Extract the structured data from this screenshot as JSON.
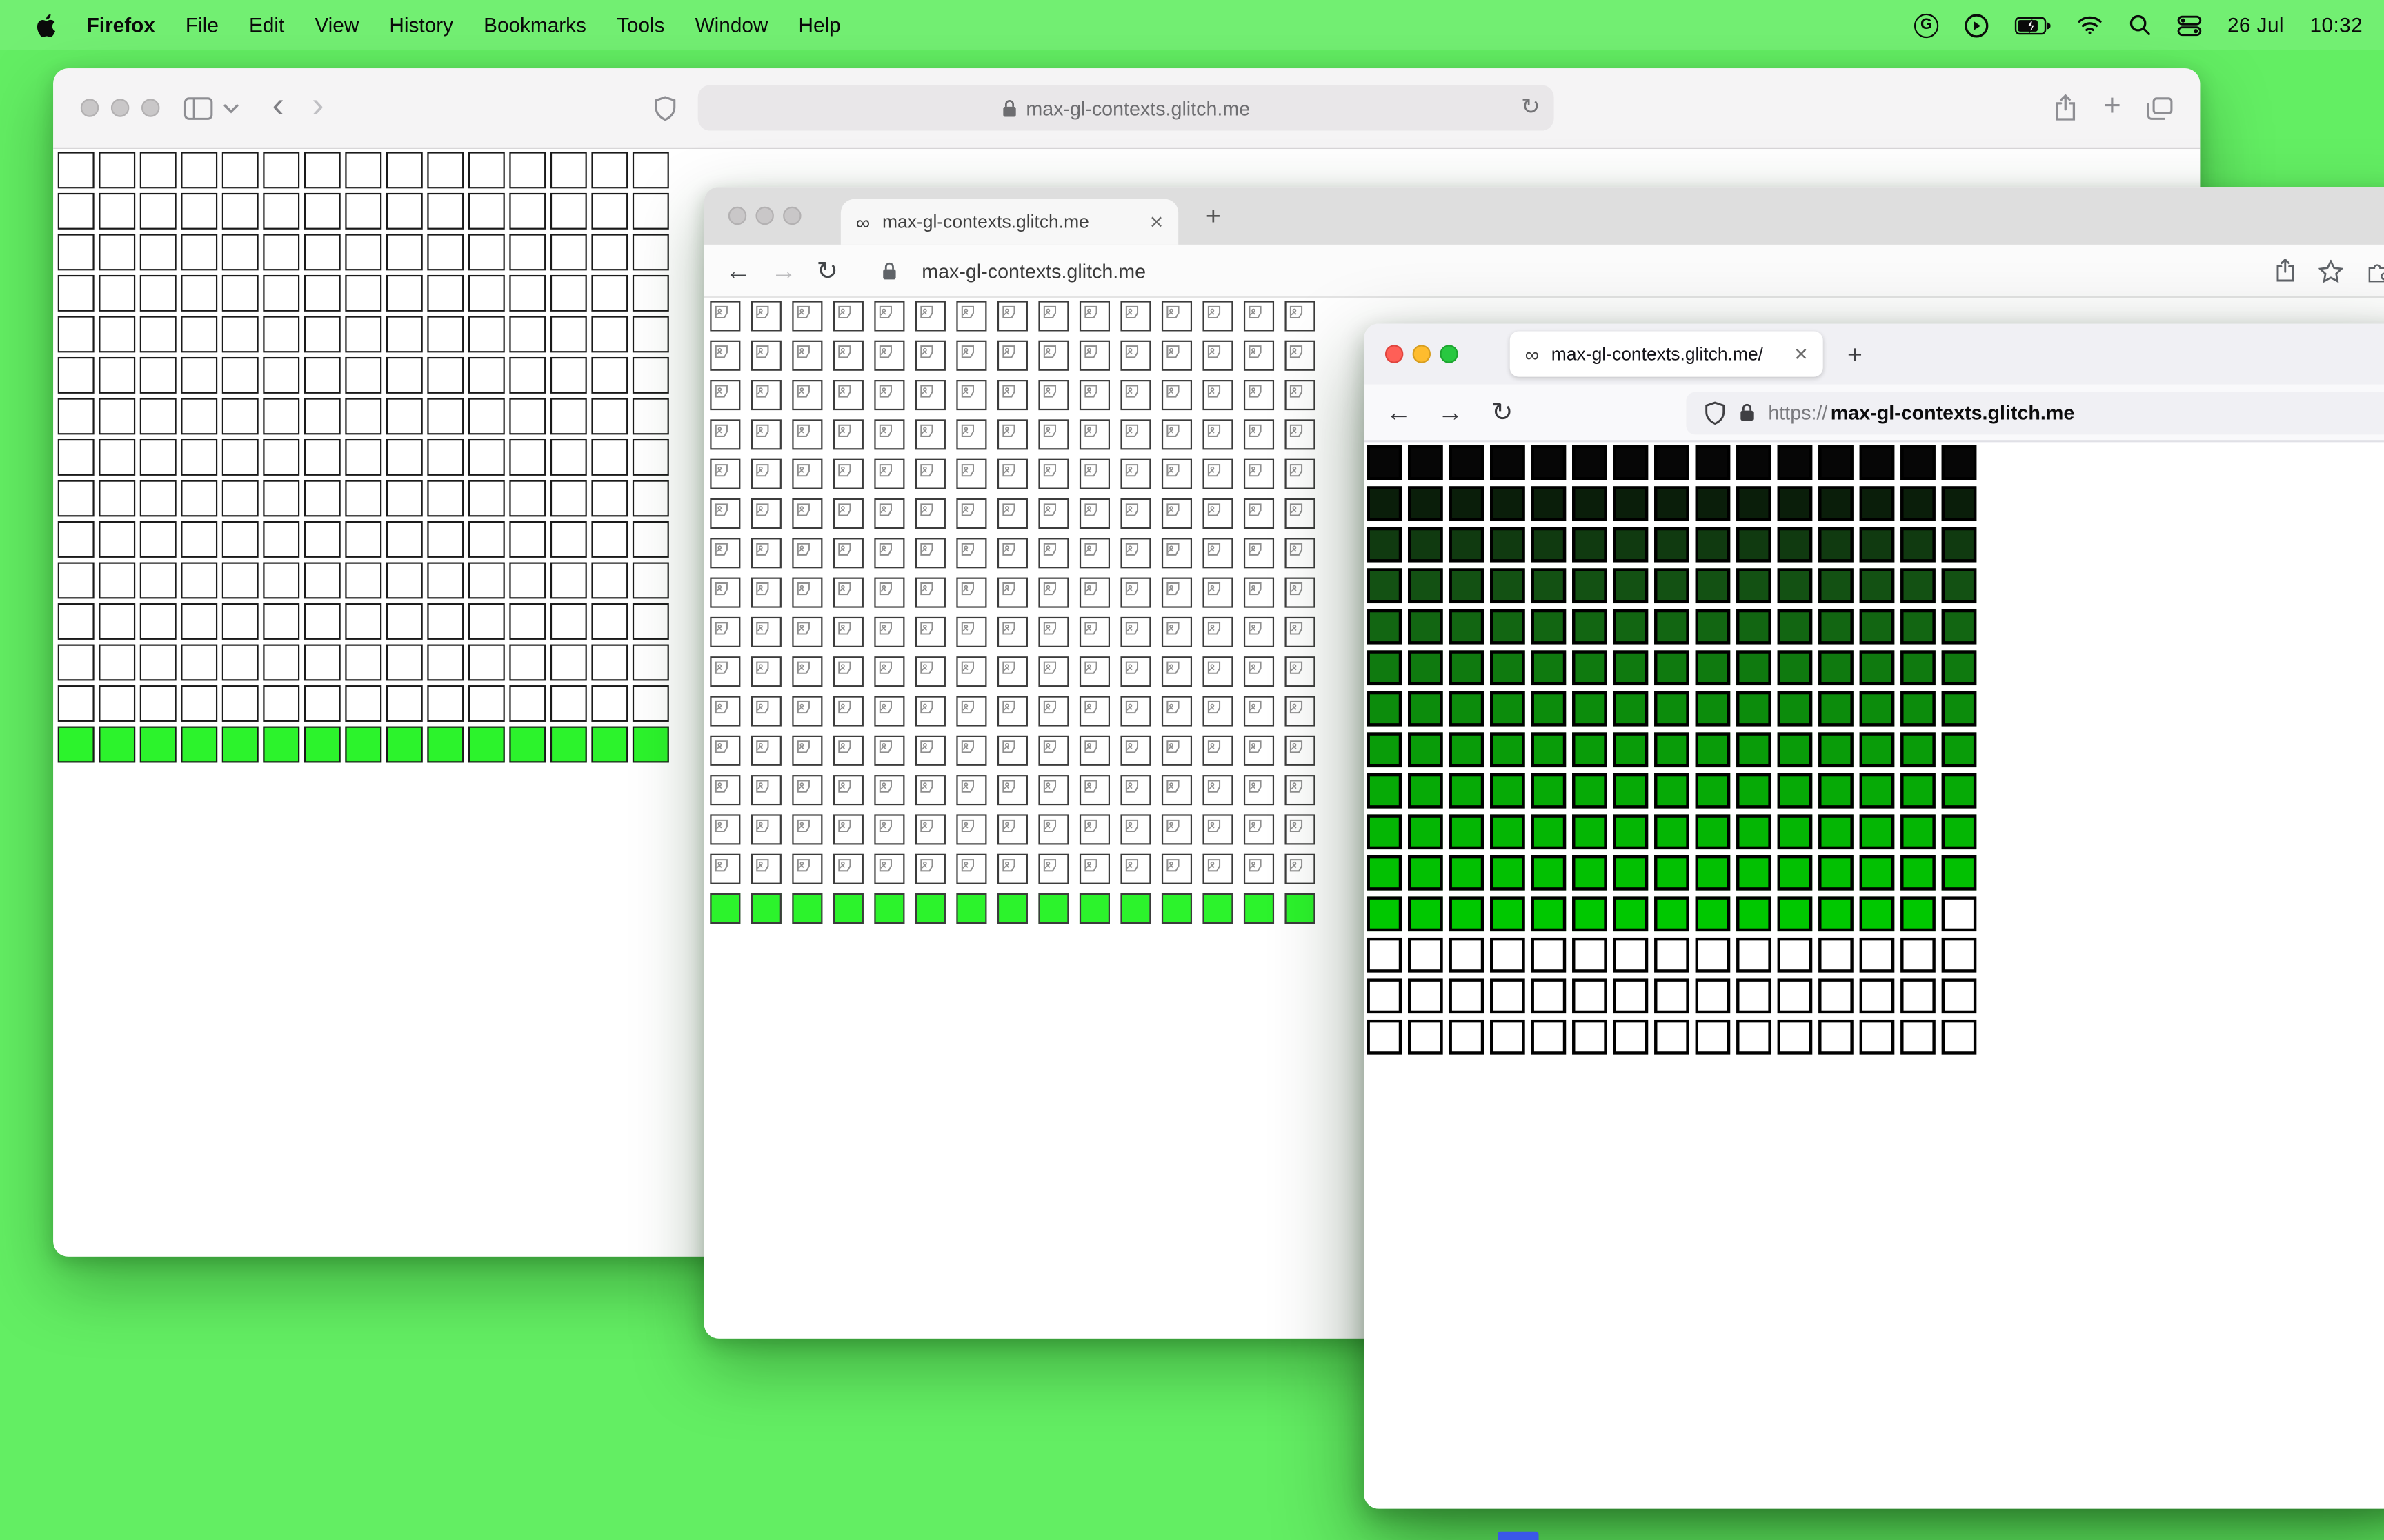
{
  "desktop": {
    "background_color": "#63ee63",
    "dock_accent_color": "#3a57e8"
  },
  "menu_bar": {
    "app_name": "Firefox",
    "menus": [
      "File",
      "Edit",
      "View",
      "History",
      "Bookmarks",
      "Tools",
      "Window",
      "Help"
    ],
    "date": "26 Jul",
    "time": "10:32",
    "status_icon_names": [
      "g-circle-icon",
      "play-circle-icon",
      "battery-charging-icon",
      "wifi-icon",
      "spotlight-search-icon",
      "control-center-icon"
    ]
  },
  "glyphs": {
    "infinity": "∞",
    "close": "×",
    "plus": "+",
    "back_chevron": "‹",
    "forward_chevron": "›",
    "back_arrow": "←",
    "forward_arrow": "→",
    "reload": "↻",
    "g_letter": "G"
  },
  "windows": {
    "safari": {
      "url": "max-gl-contexts.glitch.me"
    },
    "chrome": {
      "tab_title": "max-gl-contexts.glitch.me",
      "url": "max-gl-contexts.glitch.me"
    },
    "firefox": {
      "tab_title": "max-gl-contexts.glitch.me/",
      "url_scheme": "https://",
      "url_host": "max-gl-contexts.glitch.me"
    }
  },
  "grids": {
    "safari_grid": {
      "cols": 15,
      "cell": 24,
      "gap": 3,
      "border": "1.5px solid #1a1a1a",
      "rows": [
        {
          "fill": "#ffffff",
          "count": 14
        },
        {
          "fill": "#2cf32c",
          "count": 1
        }
      ]
    },
    "chrome_grid": {
      "cols": 15,
      "cell": 20,
      "col_gap": 7,
      "row_gap": 6,
      "border": "1px solid #3c3c3c",
      "rows": [
        {
          "fill": "broken",
          "count": 15
        },
        {
          "fill": "#2cf32c",
          "count": 1
        }
      ]
    },
    "firefox_grid": {
      "cols": 15,
      "cell": 23,
      "gap": 4,
      "border": "2px solid #000000",
      "rows": [
        {
          "fill": "#060606",
          "count": 1
        },
        {
          "fill": "#0a1e0a",
          "count": 1
        },
        {
          "fill": "#103a10",
          "count": 1
        },
        {
          "fill": "#135113",
          "count": 1
        },
        {
          "fill": "#126612",
          "count": 1
        },
        {
          "fill": "#0f7a0f",
          "count": 1
        },
        {
          "fill": "#0c8c0c",
          "count": 1
        },
        {
          "fill": "#099c09",
          "count": 1
        },
        {
          "fill": "#06aa06",
          "count": 1
        },
        {
          "fill": "#04b604",
          "count": 1
        },
        {
          "fill": "#02c002",
          "count": 1
        },
        {
          "fill": "#00c800",
          "count": 1,
          "last_cell": "#ffffff"
        },
        {
          "fill": "#ffffff",
          "count": 3
        }
      ]
    }
  }
}
